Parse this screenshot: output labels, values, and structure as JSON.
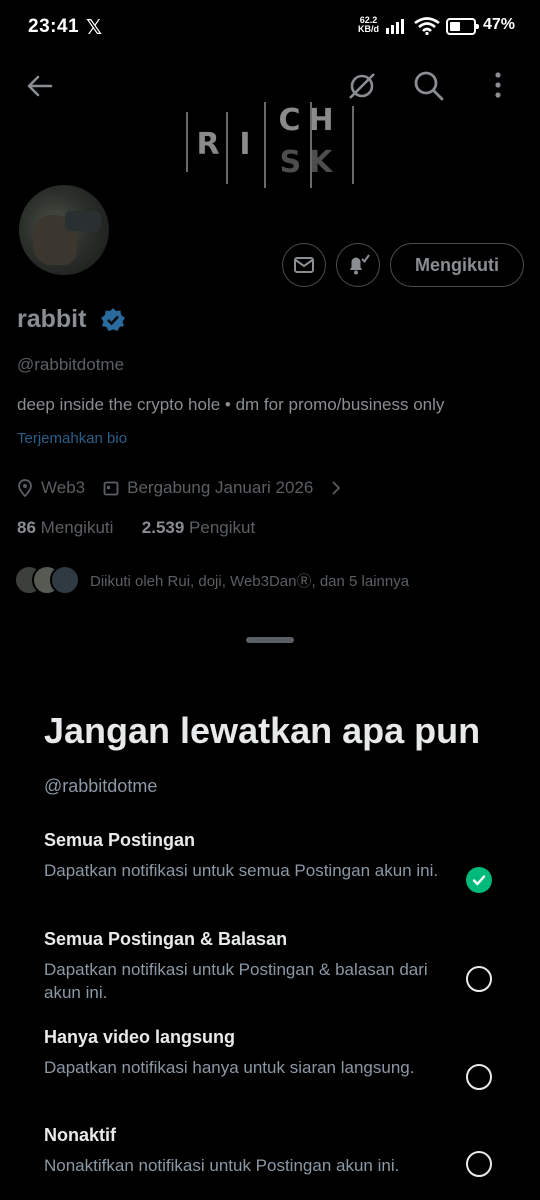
{
  "status_bar": {
    "time": "23:41",
    "app_icon": "x-logo",
    "net_speed_value": "62.2",
    "net_speed_unit": "KB/d",
    "battery_level": "47%",
    "battery_fraction": 0.47
  },
  "banner": {
    "logo_text": [
      "R",
      "I",
      "CH",
      "SK"
    ]
  },
  "profile": {
    "follow_button_label": "Mengikuti",
    "name": "rabbit",
    "handle": "@rabbitdotme",
    "bio": "deep inside the crypto hole • dm for promo/business only",
    "translate_bio": "Terjemahkan bio",
    "location": "Web3",
    "joined": "Bergabung Januari 2026",
    "following_count": "86",
    "following_label": "Mengikuti",
    "followers_count": "2.539",
    "followers_label": "Pengikut",
    "followed_by": "Diikuti oleh Rui, doji, Web3DanⓇ, dan 5 lainnya"
  },
  "sheet": {
    "title": "Jangan lewatkan apa pun",
    "handle": "@rabbitdotme",
    "options": [
      {
        "title": "Semua Postingan",
        "description": "Dapatkan notifikasi untuk semua Postingan akun ini.",
        "selected": true
      },
      {
        "title": "Semua Postingan & Balasan",
        "description": "Dapatkan notifikasi untuk Postingan & balasan dari akun ini.",
        "selected": false
      },
      {
        "title": "Hanya video langsung",
        "description": "Dapatkan notifikasi hanya untuk siaran langsung.",
        "selected": false
      },
      {
        "title": "Nonaktif",
        "description": "Nonaktifkan notifikasi untuk Postingan akun ini.",
        "selected": false
      }
    ]
  },
  "colors": {
    "accent_blue": "#1d9bf0",
    "selected_green": "#00ba7c",
    "background": "#000000"
  }
}
